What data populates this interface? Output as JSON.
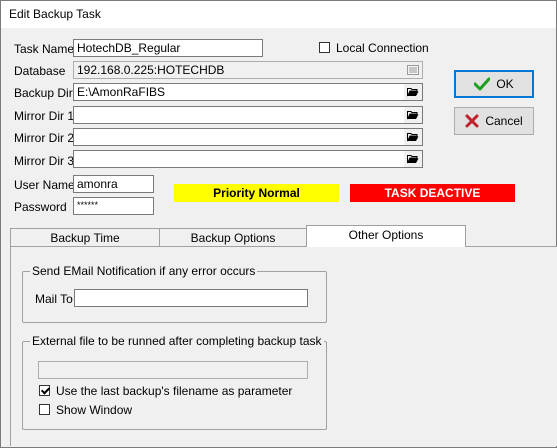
{
  "window": {
    "title": "Edit Backup Task"
  },
  "form": {
    "task_name": {
      "label": "Task Name",
      "value": "HotechDB_Regular"
    },
    "local_connection": {
      "label": "Local Connection",
      "checked": false
    },
    "database": {
      "label": "Database",
      "value": "192.168.0.225:HOTECHDB"
    },
    "backup_dir": {
      "label": "Backup Dir",
      "value": "E:\\AmonRaFIBS"
    },
    "mirror_dir_1": {
      "label": "Mirror Dir 1",
      "value": ""
    },
    "mirror_dir_2": {
      "label": "Mirror Dir 2",
      "value": ""
    },
    "mirror_dir_3": {
      "label": "Mirror Dir 3",
      "value": ""
    },
    "user_name": {
      "label": "User Name",
      "value": "amonra"
    },
    "password": {
      "label": "Password",
      "value": "******"
    }
  },
  "status": {
    "priority": {
      "text": "Priority Normal",
      "color": "#ffff00",
      "text_color": "#000000"
    },
    "task_state": {
      "text": "TASK DEACTIVE",
      "color": "#ff0000",
      "text_color": "#ffffff"
    }
  },
  "buttons": {
    "ok": {
      "label": "OK",
      "icon": "checkmark-icon",
      "color": "#1e9e1e"
    },
    "cancel": {
      "label": "Cancel",
      "icon": "x-icon",
      "color": "#c0202a"
    }
  },
  "tabs": [
    {
      "label": "Backup Time",
      "active": false
    },
    {
      "label": "Backup Options",
      "active": false
    },
    {
      "label": "Other Options",
      "active": true
    }
  ],
  "other_options": {
    "email_group": {
      "legend": "Send EMail Notification if any error occurs",
      "mail_to_label": "Mail To",
      "mail_to_value": ""
    },
    "external_group": {
      "legend": "External file to be runned after completing backup task",
      "file_value": "",
      "use_last_filename": {
        "label": "Use the last backup's filename as parameter",
        "checked": true
      },
      "show_window": {
        "label": "Show Window",
        "checked": false
      }
    }
  }
}
